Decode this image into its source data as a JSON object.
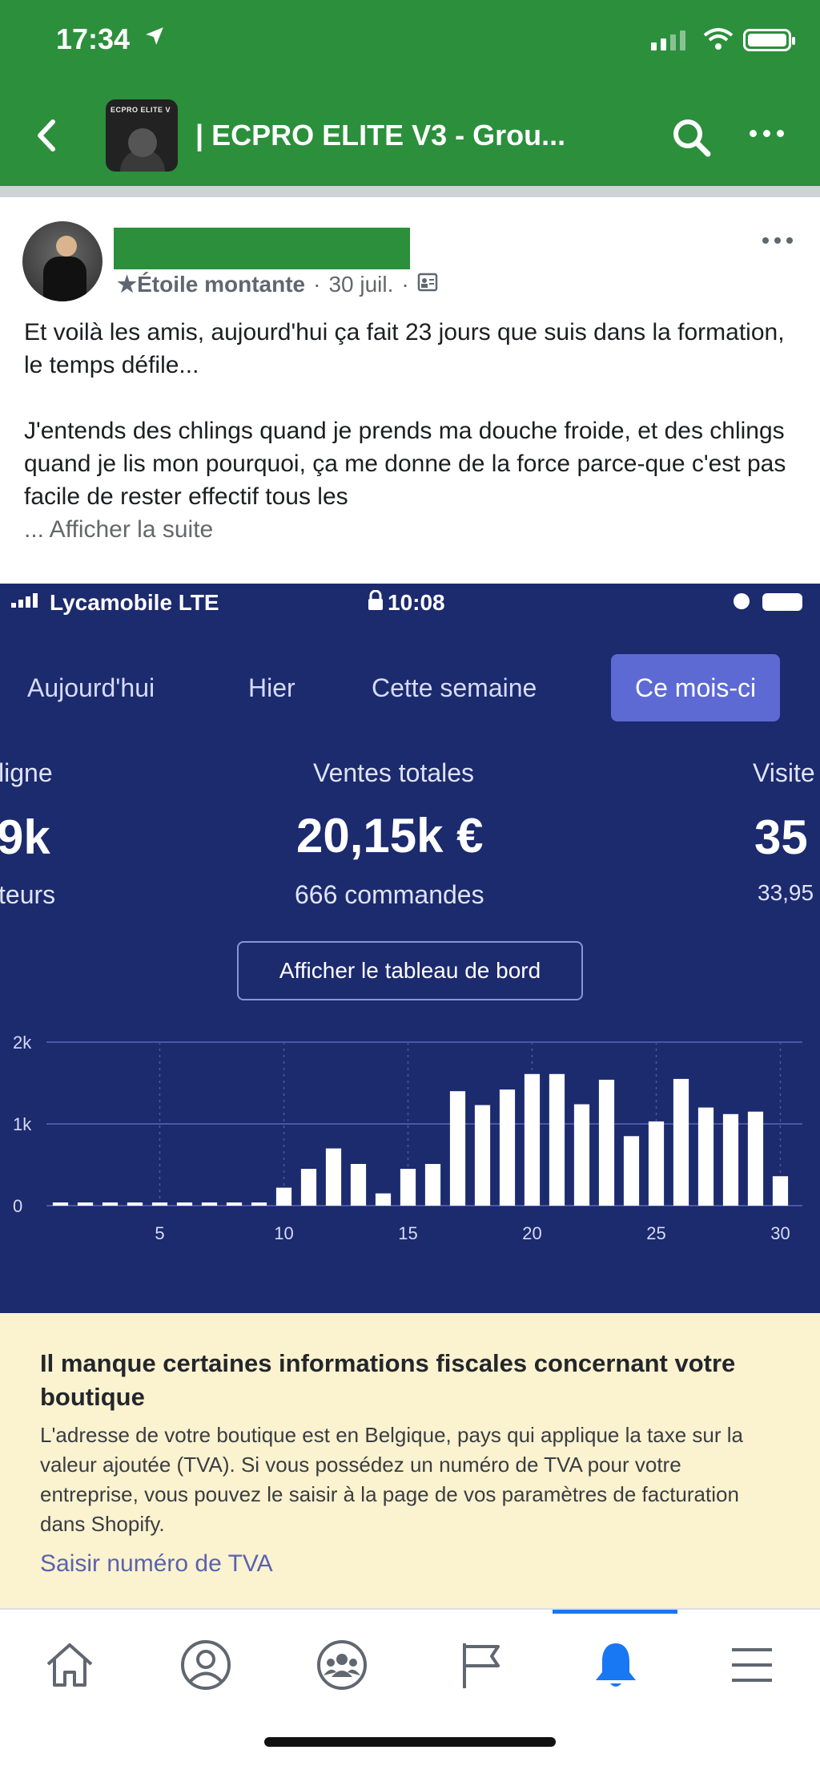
{
  "status_bar": {
    "time": "17:34"
  },
  "header": {
    "title": "| ECPRO ELITE V3 - Grou...",
    "thumb_label": "ECPRO ELITE V"
  },
  "post": {
    "badge": "★Étoile montante",
    "date": "30 juil.",
    "paragraph1": "Et voilà les amis, aujourd'hui ça fait 23 jours que suis dans la formation, le temps défile...",
    "paragraph2": "J'entends des chlings quand je prends ma douche froide, et des chlings quand je lis mon pourquoi, ça me donne de la force parce-que c'est pas facile de rester effectif tous les",
    "see_more": "... Afficher la suite"
  },
  "shopify": {
    "carrier": "Lycamobile LTE",
    "time": "10:08",
    "tabs": [
      "Aujourd'hui",
      "Hier",
      "Cette semaine",
      "Ce mois-ci"
    ],
    "active_tab": "Ce mois-ci",
    "left_kpi": {
      "label": "ligne",
      "value": "9k",
      "sub": "teurs"
    },
    "center_kpi": {
      "label": "Ventes totales",
      "value": "20,15k €",
      "sub": "666 commandes"
    },
    "right_kpi": {
      "label": "Visite",
      "value": "35",
      "sub": "33,95"
    },
    "dashboard_button": "Afficher le tableau de bord"
  },
  "chart_data": {
    "type": "bar",
    "x": [
      1,
      2,
      3,
      4,
      5,
      6,
      7,
      8,
      9,
      10,
      11,
      12,
      13,
      14,
      15,
      16,
      17,
      18,
      19,
      20,
      21,
      22,
      23,
      24,
      25,
      26,
      27,
      28,
      29,
      30
    ],
    "values": [
      0,
      0,
      0,
      0,
      0,
      0,
      0,
      0,
      0,
      220,
      450,
      700,
      510,
      150,
      450,
      510,
      1400,
      1230,
      1420,
      1610,
      1610,
      1240,
      1540,
      850,
      1030,
      1550,
      1200,
      1120,
      1150,
      360
    ],
    "xticks": [
      "5",
      "10",
      "15",
      "20",
      "25",
      "30"
    ],
    "yticks": [
      "0",
      "1k",
      "2k"
    ],
    "ylim": [
      0,
      2000
    ],
    "colors": {
      "bar": "#ffffff",
      "zero_dash": "#ffffff",
      "grid": "#4a57a8",
      "background": "#1c2a6e"
    }
  },
  "notice": {
    "title": "Il manque certaines informations fiscales concernant votre boutique",
    "body": "L'adresse de votre boutique est en Belgique, pays qui applique la taxe sur la valeur ajoutée (TVA). Si vous possédez un numéro de TVA pour votre entreprise, vous pouvez le saisir à la page de vos paramètres de facturation dans Shopify.",
    "link": "Saisir numéro de TVA"
  },
  "bottom_nav": {
    "items": [
      "home-icon",
      "profile-icon",
      "groups-icon",
      "pages-flag-icon",
      "notifications-bell-icon",
      "menu-icon"
    ],
    "active": "notifications-bell-icon",
    "active_color": "#1877f2"
  }
}
